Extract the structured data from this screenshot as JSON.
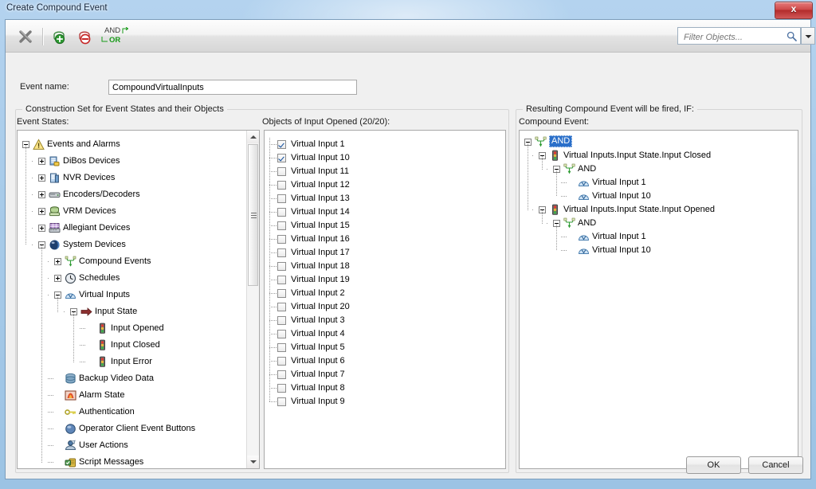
{
  "window": {
    "title": "Create Compound Event",
    "close_label": "x"
  },
  "toolbar": {
    "delete_icon": "x-delete-icon",
    "add_icon": "add-state-icon",
    "remove_icon": "remove-state-icon",
    "andor_and": "AND",
    "andor_or": "OR",
    "filter_placeholder": "Filter Objects...",
    "filter_value": "",
    "search_icon": "search-icon",
    "dropdown_icon": "chevron-down-icon"
  },
  "form": {
    "event_name_label": "Event name:",
    "event_name_value": "CompoundVirtualInputs"
  },
  "construction_group": {
    "title": "Construction Set for Event States and their Objects",
    "event_states_label": "Event States:",
    "objects_label": "Objects of Input Opened (20/20):"
  },
  "result_group": {
    "title": "Resulting Compound Event will be fired, IF:",
    "compound_event_label": "Compound Event:"
  },
  "event_tree": [
    {
      "label": "Events and Alarms",
      "depth": 0,
      "expander": "minus",
      "icon": "warning-icon"
    },
    {
      "label": "DiBos Devices",
      "depth": 1,
      "expander": "plus",
      "icon": "dibos-device-icon"
    },
    {
      "label": "NVR Devices",
      "depth": 1,
      "expander": "plus",
      "icon": "nvr-device-icon"
    },
    {
      "label": "Encoders/Decoders",
      "depth": 1,
      "expander": "plus",
      "icon": "encoder-decoder-icon"
    },
    {
      "label": "VRM Devices",
      "depth": 1,
      "expander": "plus",
      "icon": "vrm-device-icon"
    },
    {
      "label": "Allegiant Devices",
      "depth": 1,
      "expander": "plus",
      "icon": "allegiant-device-icon"
    },
    {
      "label": "System Devices",
      "depth": 1,
      "expander": "minus",
      "icon": "system-device-icon"
    },
    {
      "label": "Compound Events",
      "depth": 2,
      "expander": "plus",
      "icon": "compound-event-icon"
    },
    {
      "label": "Schedules",
      "depth": 2,
      "expander": "plus",
      "icon": "schedule-clock-icon"
    },
    {
      "label": "Virtual Inputs",
      "depth": 2,
      "expander": "minus",
      "icon": "virtual-input-icon"
    },
    {
      "label": "Input State",
      "depth": 3,
      "expander": "minus",
      "icon": "input-state-arrow-icon"
    },
    {
      "label": "Input Opened",
      "depth": 4,
      "expander": "none",
      "icon": "traffic-light-icon"
    },
    {
      "label": "Input Closed",
      "depth": 4,
      "expander": "none",
      "icon": "traffic-light-icon"
    },
    {
      "label": "Input Error",
      "depth": 4,
      "expander": "none",
      "icon": "traffic-light-icon"
    },
    {
      "label": "Backup Video Data",
      "depth": 2,
      "expander": "none",
      "icon": "database-icon"
    },
    {
      "label": "Alarm State",
      "depth": 2,
      "expander": "none",
      "icon": "alarm-state-icon"
    },
    {
      "label": "Authentication",
      "depth": 2,
      "expander": "none",
      "icon": "key-icon"
    },
    {
      "label": "Operator Client Event Buttons",
      "depth": 2,
      "expander": "none",
      "icon": "blue-sphere-icon"
    },
    {
      "label": "User Actions",
      "depth": 2,
      "expander": "none",
      "icon": "user-action-icon"
    },
    {
      "label": "Script Messages",
      "depth": 2,
      "expander": "none",
      "icon": "script-message-icon"
    }
  ],
  "objects_list": [
    {
      "label": "Virtual Input 1",
      "checked": true
    },
    {
      "label": "Virtual Input 10",
      "checked": true
    },
    {
      "label": "Virtual Input 11",
      "checked": false
    },
    {
      "label": "Virtual Input 12",
      "checked": false
    },
    {
      "label": "Virtual Input 13",
      "checked": false
    },
    {
      "label": "Virtual Input 14",
      "checked": false
    },
    {
      "label": "Virtual Input 15",
      "checked": false
    },
    {
      "label": "Virtual Input 16",
      "checked": false
    },
    {
      "label": "Virtual Input 17",
      "checked": false
    },
    {
      "label": "Virtual Input 18",
      "checked": false
    },
    {
      "label": "Virtual Input 19",
      "checked": false
    },
    {
      "label": "Virtual Input 2",
      "checked": false
    },
    {
      "label": "Virtual Input 20",
      "checked": false
    },
    {
      "label": "Virtual Input 3",
      "checked": false
    },
    {
      "label": "Virtual Input 4",
      "checked": false
    },
    {
      "label": "Virtual Input 5",
      "checked": false
    },
    {
      "label": "Virtual Input 6",
      "checked": false
    },
    {
      "label": "Virtual Input 7",
      "checked": false
    },
    {
      "label": "Virtual Input 8",
      "checked": false
    },
    {
      "label": "Virtual Input 9",
      "checked": false
    }
  ],
  "compound_tree": [
    {
      "label": "AND",
      "depth": 0,
      "expander": "minus",
      "icon": "and-operator-icon",
      "selected": true
    },
    {
      "label": "Virtual Inputs.Input State.Input Closed",
      "depth": 1,
      "expander": "minus",
      "icon": "traffic-light-icon",
      "selected": false
    },
    {
      "label": "AND",
      "depth": 2,
      "expander": "minus",
      "icon": "and-operator-icon",
      "selected": false
    },
    {
      "label": "Virtual Input 1",
      "depth": 3,
      "expander": "none",
      "icon": "virtual-input-icon",
      "selected": false
    },
    {
      "label": "Virtual Input 10",
      "depth": 3,
      "expander": "none",
      "icon": "virtual-input-icon",
      "selected": false
    },
    {
      "label": "Virtual Inputs.Input State.Input Opened",
      "depth": 1,
      "expander": "minus",
      "icon": "traffic-light-icon",
      "selected": false
    },
    {
      "label": "AND",
      "depth": 2,
      "expander": "minus",
      "icon": "and-operator-icon",
      "selected": false
    },
    {
      "label": "Virtual Input 1",
      "depth": 3,
      "expander": "none",
      "icon": "virtual-input-icon",
      "selected": false
    },
    {
      "label": "Virtual Input 10",
      "depth": 3,
      "expander": "none",
      "icon": "virtual-input-icon",
      "selected": false
    }
  ],
  "footer": {
    "ok_label": "OK",
    "cancel_label": "Cancel"
  },
  "colors": {
    "titlebar": "#a8cbe9",
    "selection": "#2a6fc9",
    "close_red": "#cf4a4a",
    "or_green": "#179a18"
  }
}
